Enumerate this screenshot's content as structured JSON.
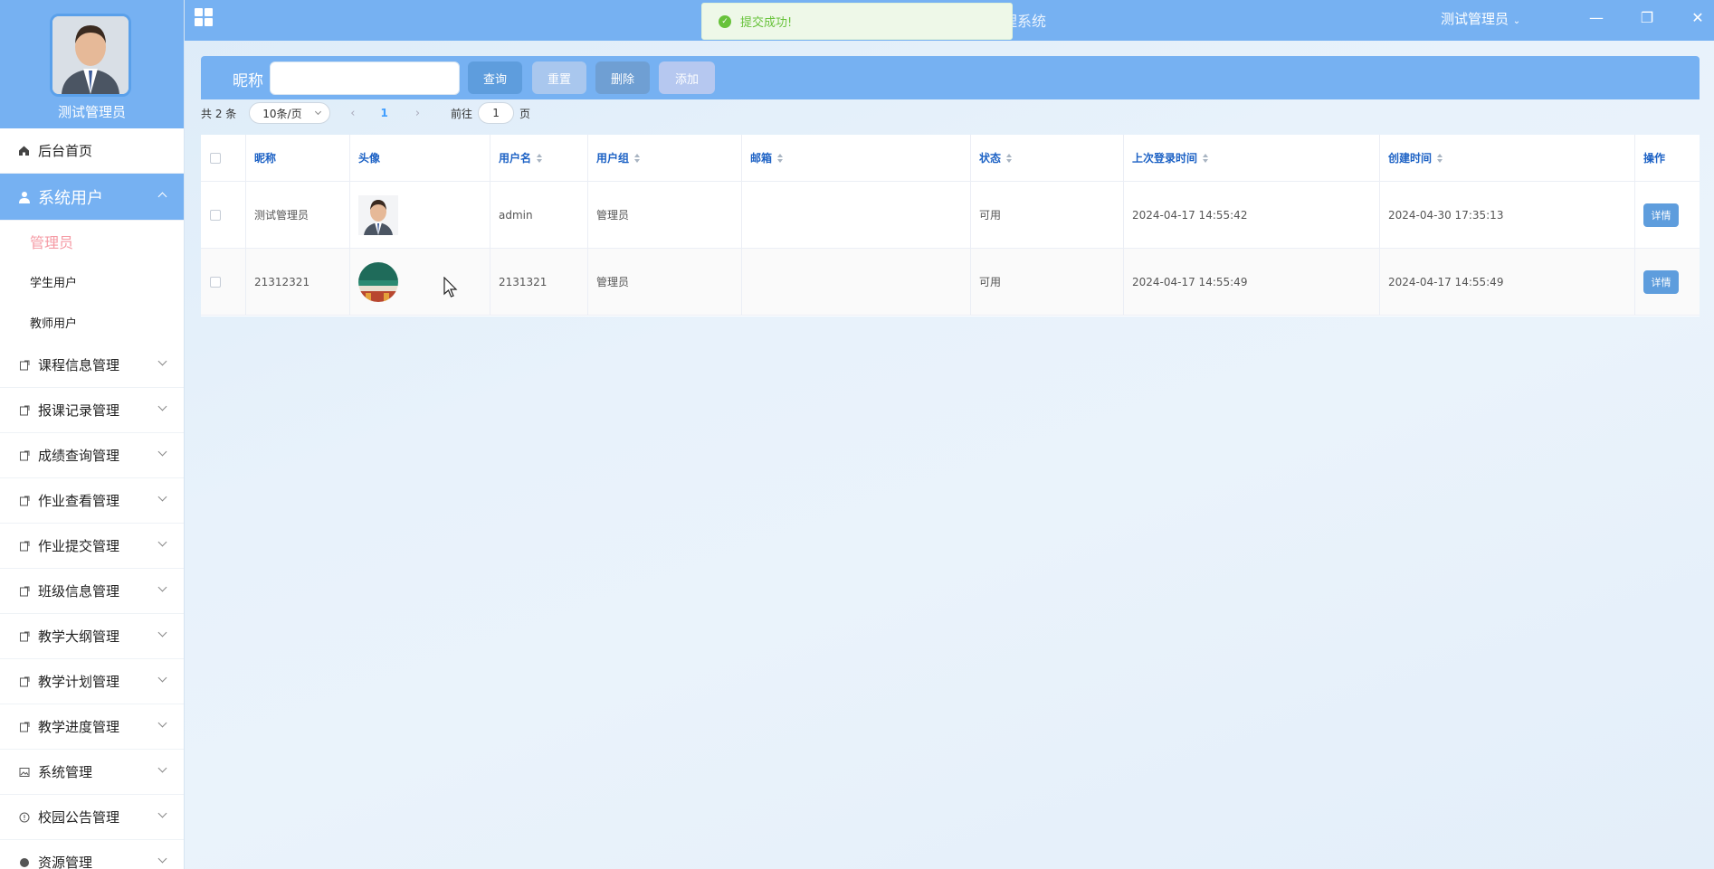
{
  "sidebar": {
    "profile_name": "测试管理员",
    "home_label": "后台首页",
    "system_users_label": "系统用户",
    "sub_items": [
      "管理员",
      "学生用户",
      "教师用户"
    ],
    "menu": [
      {
        "label": "课程信息管理",
        "icon": "file-icon"
      },
      {
        "label": "报课记录管理",
        "icon": "file-icon"
      },
      {
        "label": "成绩查询管理",
        "icon": "file-icon"
      },
      {
        "label": "作业查看管理",
        "icon": "file-icon"
      },
      {
        "label": "作业提交管理",
        "icon": "file-icon"
      },
      {
        "label": "班级信息管理",
        "icon": "file-icon"
      },
      {
        "label": "教学大纲管理",
        "icon": "file-icon"
      },
      {
        "label": "教学计划管理",
        "icon": "file-icon"
      },
      {
        "label": "教学进度管理",
        "icon": "file-icon"
      },
      {
        "label": "系统管理",
        "icon": "picture-icon"
      },
      {
        "label": "校园公告管理",
        "icon": "warning-icon"
      },
      {
        "label": "资源管理",
        "icon": "circle-icon"
      }
    ]
  },
  "header": {
    "title": "欢迎使用教学进度管理系统",
    "user": "测试管理员"
  },
  "toast": {
    "message": "提交成功!"
  },
  "toolbar": {
    "search_label": "昵称",
    "search_placeholder": "",
    "query_label": "查询",
    "reset_label": "重置",
    "delete_label": "删除",
    "add_label": "添加"
  },
  "pagination": {
    "total": "共 2 条",
    "page_size": "10条/页",
    "current_page": "1",
    "goto_label": "前往",
    "goto_value": "1",
    "page_unit": "页"
  },
  "table": {
    "columns": [
      "昵称",
      "头像",
      "用户名",
      "用户组",
      "邮箱",
      "状态",
      "上次登录时间",
      "创建时间",
      "操作"
    ],
    "rows": [
      {
        "nickname": "测试管理员",
        "username": "admin",
        "group": "管理员",
        "email": "",
        "status": "可用",
        "last_login": "2024-04-17 14:55:42",
        "created": "2024-04-30 17:35:13",
        "action": "详情"
      },
      {
        "nickname": "21312321",
        "username": "2131321",
        "group": "管理员",
        "email": "",
        "status": "可用",
        "last_login": "2024-04-17 14:55:49",
        "created": "2024-04-17 14:55:49",
        "action": "详情"
      }
    ]
  },
  "colors": {
    "primary": "#76b1f2",
    "accent_pink": "#f59aa4",
    "header_text": "#1d62c5",
    "success": "#67c23a"
  }
}
